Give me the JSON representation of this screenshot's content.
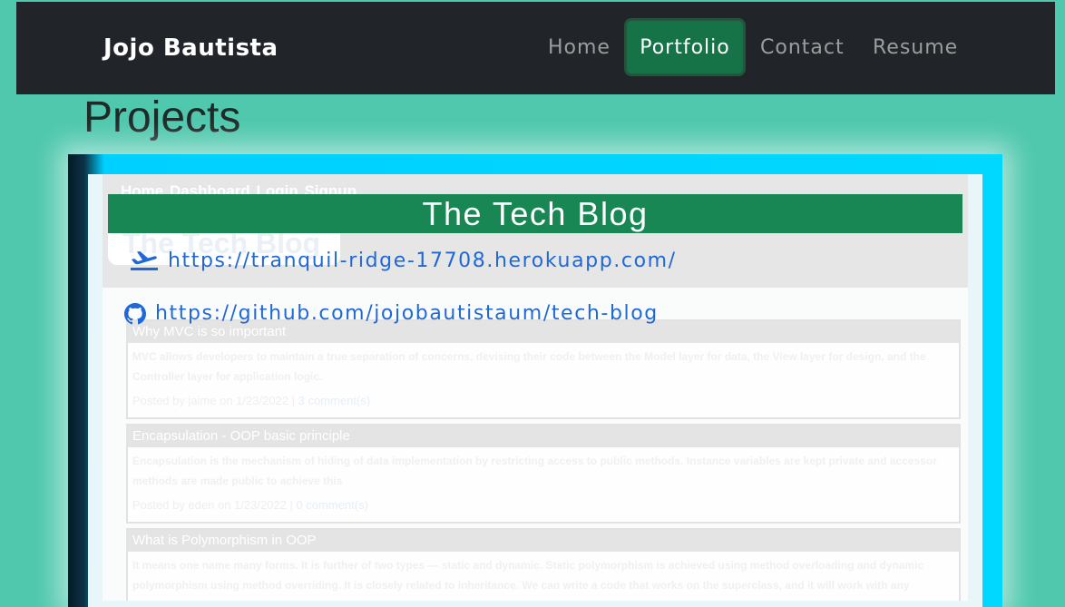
{
  "navbar": {
    "brand": "Jojo Bautista",
    "links": [
      {
        "label": "Home"
      },
      {
        "label": "Portfolio",
        "active": true
      },
      {
        "label": "Contact"
      },
      {
        "label": "Resume"
      }
    ]
  },
  "section": {
    "title": "Projects"
  },
  "project": {
    "title": "The Tech Blog",
    "deployed_url": "https://tranquil-ridge-17708.herokuapp.com/",
    "repo_url": "https://github.com/jojobautistaum/tech-blog",
    "icons": {
      "deployed": "airplane-icon",
      "repo": "github-icon"
    },
    "preview": {
      "nav": "Home  Dashboard  Login  Signup",
      "logo": "The Tech Blog",
      "posts": [
        {
          "title": "Why MVC is so important",
          "body": "MVC allows developers to maintain a true separation of concerns, devising their code between the Model layer for data, the View layer for design, and the Controller layer for application logic.",
          "meta": "Posted by jaime on 1/23/2022 | ",
          "comments": "3 comment(s)"
        },
        {
          "title": "Encapsulation - OOP basic principle",
          "body": "Encapsulation is the mechanism of hiding of data implementation by restricting access to public methods. Instance variables are kept private and accessor methods are made public to achieve this",
          "meta": "Posted by eden on 1/23/2022 | ",
          "comments": "0 comment(s)"
        },
        {
          "title": "What is Polymorphism in OOP",
          "body": "It means one name many forms. It is further of two types — static and dynamic. Static polymorphism is achieved using method overloading and dynamic polymorphism using method overriding. It is closely related to inheritance. We can write a code that works on the superclass, and it will work with any",
          "meta": "",
          "comments": ""
        }
      ]
    }
  },
  "colors": {
    "page_bg": "#4fc8ad",
    "navbar_bg": "#212529",
    "active_nav": "#157347",
    "banner": "#198754",
    "link": "#1f68d8"
  }
}
